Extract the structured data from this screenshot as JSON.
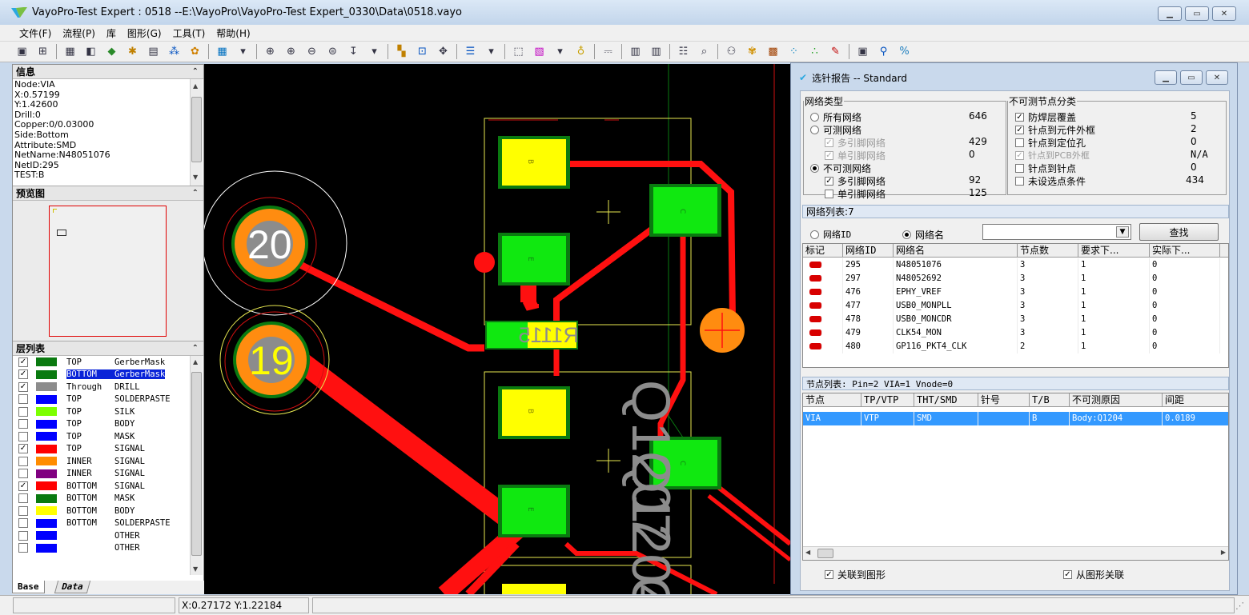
{
  "window": {
    "title": "VayoPro-Test Expert : 0518  --E:\\VayoPro\\VayoPro-Test Expert_0330\\Data\\0518.vayo"
  },
  "menu": [
    "文件(F)",
    "流程(P)",
    "库",
    "图形(G)",
    "工具(T)",
    "帮助(H)"
  ],
  "info_panel": {
    "title": "信息",
    "lines": [
      "Node:VIA",
      "X:0.57199",
      "Y:1.42600",
      "Drill:0",
      "Copper:0/0.03000",
      "Side:Bottom",
      "Attribute:SMD",
      "NetName:N48051076",
      "NetID:295",
      "TEST:B"
    ]
  },
  "preview_panel": {
    "title": "预览图"
  },
  "layer_panel": {
    "title": "层列表",
    "layers": [
      {
        "checked": true,
        "color": "#0a7a10",
        "side": "TOP",
        "type": "GerberMask"
      },
      {
        "checked": true,
        "color": "#0a7a10",
        "side": "BOTTOM",
        "type": "GerberMask",
        "selected": true
      },
      {
        "checked": true,
        "color": "#8c8c8c",
        "side": "Through",
        "type": "DRILL"
      },
      {
        "checked": false,
        "color": "#0000ff",
        "side": "TOP",
        "type": "SOLDERPASTE"
      },
      {
        "checked": false,
        "color": "#7cff00",
        "side": "TOP",
        "type": "SILK"
      },
      {
        "checked": false,
        "color": "#0000ff",
        "side": "TOP",
        "type": "BODY"
      },
      {
        "checked": false,
        "color": "#0000ff",
        "side": "TOP",
        "type": "MASK"
      },
      {
        "checked": true,
        "color": "#ff0000",
        "side": "TOP",
        "type": "SIGNAL"
      },
      {
        "checked": false,
        "color": "#ff8c00",
        "side": "INNER",
        "type": "SIGNAL"
      },
      {
        "checked": false,
        "color": "#800080",
        "side": "INNER",
        "type": "SIGNAL"
      },
      {
        "checked": true,
        "color": "#ff0000",
        "side": "BOTTOM",
        "type": "SIGNAL"
      },
      {
        "checked": false,
        "color": "#0a7a10",
        "side": "BOTTOM",
        "type": "MASK"
      },
      {
        "checked": false,
        "color": "#ffff00",
        "side": "BOTTOM",
        "type": "BODY"
      },
      {
        "checked": false,
        "color": "#0000ff",
        "side": "BOTTOM",
        "type": "SOLDERPASTE"
      },
      {
        "checked": false,
        "color": "#0000ff",
        "side": "",
        "type": "OTHER"
      },
      {
        "checked": false,
        "color": "#0000ff",
        "side": "",
        "type": "OTHER"
      }
    ]
  },
  "tabs": [
    "Base",
    "Data"
  ],
  "status": {
    "coords": "X:0.27172 Y:1.22184"
  },
  "pcb": {
    "via_labels": [
      "20",
      "19"
    ],
    "components": [
      "Q1204",
      "Q1207",
      "R1115"
    ],
    "pad_letters": [
      "B",
      "E",
      "C"
    ]
  },
  "dialog": {
    "title": "选针报告 -- Standard",
    "net_type": {
      "title": "网络类型",
      "options": [
        {
          "label": "所有网络",
          "count": "646"
        },
        {
          "label": "可测网络",
          "count": ""
        },
        {
          "label": "多引脚网络",
          "count": "429"
        },
        {
          "label": "单引脚网络",
          "count": "0"
        },
        {
          "label": "不可测网络",
          "count": ""
        },
        {
          "label": "多引脚网络",
          "count": "92"
        },
        {
          "label": "单引脚网络",
          "count": "125"
        }
      ]
    },
    "untestable": {
      "title": "不可测节点分类",
      "options": [
        {
          "label": "防焊层覆盖",
          "count": "5"
        },
        {
          "label": "针点到元件外框",
          "count": "2"
        },
        {
          "label": "针点到定位孔",
          "count": "0"
        },
        {
          "label": "针点到PCB外框",
          "count": "N/A"
        },
        {
          "label": "针点到针点",
          "count": "0"
        },
        {
          "label": "未设选点条件",
          "count": "434"
        }
      ]
    },
    "net_list": {
      "header": "网络列表:7",
      "radio_id": "网络ID",
      "radio_name": "网络名",
      "search_button": "查找",
      "columns": [
        "标记",
        "网络ID",
        "网络名",
        "节点数",
        "要求下...",
        "实际下..."
      ],
      "rows": [
        {
          "id": "295",
          "name": "N48051076",
          "nodes": "3",
          "req": "1",
          "act": "0"
        },
        {
          "id": "297",
          "name": "N48052692",
          "nodes": "3",
          "req": "1",
          "act": "0"
        },
        {
          "id": "476",
          "name": "EPHY_VREF",
          "nodes": "3",
          "req": "1",
          "act": "0"
        },
        {
          "id": "477",
          "name": "USB0_MONPLL",
          "nodes": "3",
          "req": "1",
          "act": "0"
        },
        {
          "id": "478",
          "name": "USB0_MONCDR",
          "nodes": "3",
          "req": "1",
          "act": "0"
        },
        {
          "id": "479",
          "name": "CLK54_MON",
          "nodes": "3",
          "req": "1",
          "act": "0"
        },
        {
          "id": "480",
          "name": "GP116_PKT4_CLK",
          "nodes": "2",
          "req": "1",
          "act": "0"
        }
      ]
    },
    "node_list": {
      "header": "节点列表:   Pin=2  VIA=1  Vnode=0",
      "columns": [
        "节点",
        "TP/VTP",
        "THT/SMD",
        "针号",
        "T/B",
        "不可测原因",
        "间距"
      ],
      "rows": [
        {
          "node": "VIA",
          "tp": "VTP",
          "tht": "SMD",
          "pin": "",
          "tb": "B",
          "reason": "Body:Q1204",
          "gap": "0.0189"
        }
      ]
    },
    "link_to_graphic": "关联到图形",
    "link_from_graphic": "从图形关联"
  }
}
